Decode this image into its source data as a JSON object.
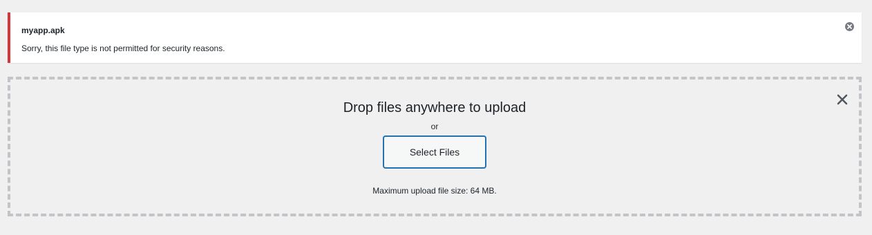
{
  "notice": {
    "filename": "myapp.apk",
    "message": "Sorry, this file type is not permitted for security reasons.",
    "dismiss_icon": "close-circle-icon",
    "accent_color": "#d63638"
  },
  "uploader": {
    "title": "Drop files anywhere to upload",
    "or_text": "or",
    "select_button_label": "Select Files",
    "max_size_text": "Maximum upload file size: 64 MB.",
    "close_icon": "close-icon",
    "button_border_color": "#2271b1"
  }
}
